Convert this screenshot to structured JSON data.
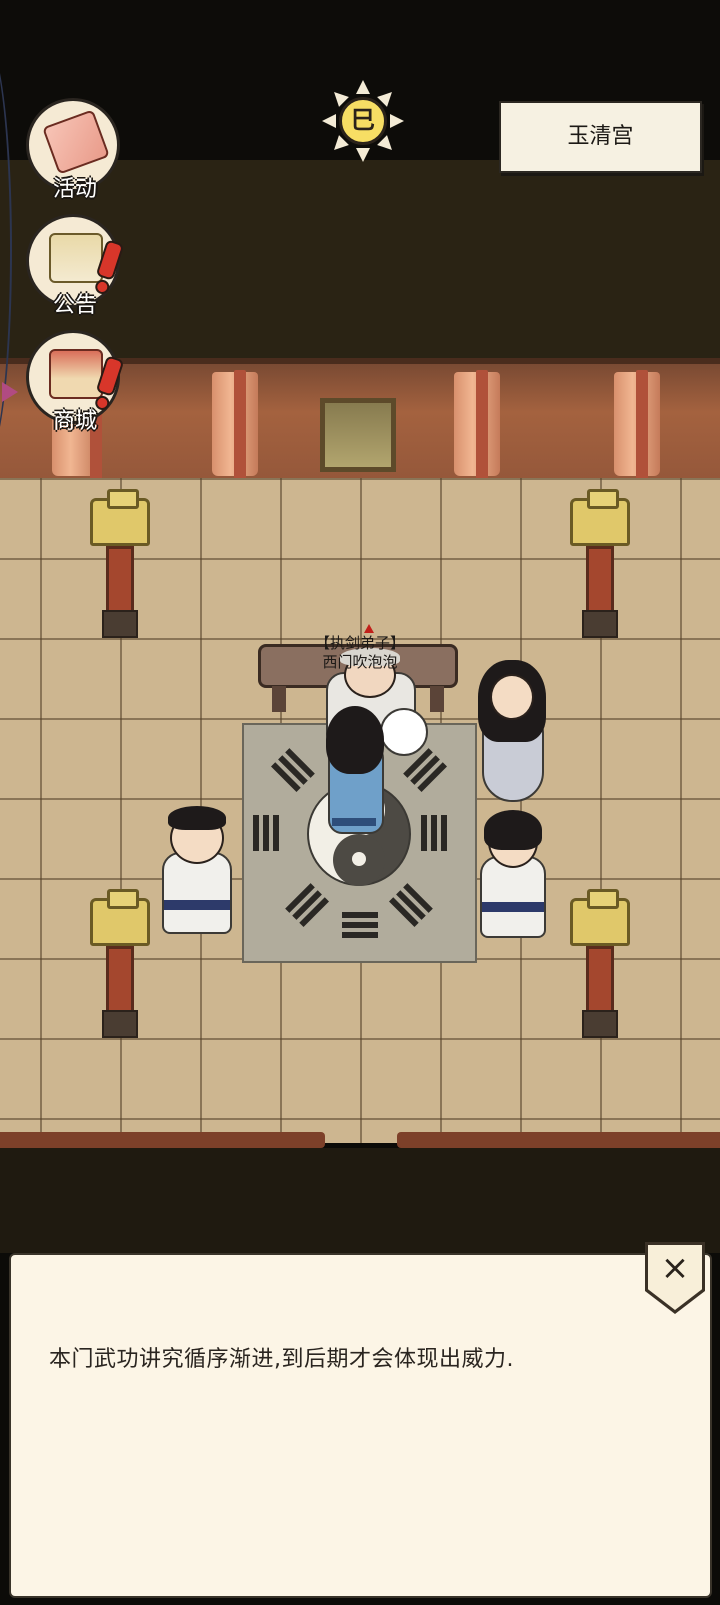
{
  "location": {
    "name": "玉清宫"
  },
  "sun_emblem": {
    "glyph": "巳"
  },
  "menu": [
    {
      "label": "活动",
      "icon": "banner-flag-icon",
      "alert": false
    },
    {
      "label": "公告",
      "icon": "notice-pavilion-icon",
      "alert": true
    },
    {
      "label": "商城",
      "icon": "shop-stall-icon",
      "alert": true
    }
  ],
  "npc": {
    "title": "【执剑弟子】",
    "name": "西门吹泡泡"
  },
  "dialog": {
    "text": "本门武功讲究循序渐进,到后期才会体现出威力.",
    "close_label": "×"
  },
  "colors": {
    "floor": "#cdb690",
    "wall": "#a4623f",
    "dialog_bg": "#fcf5e6",
    "alert": "#d8362a"
  }
}
